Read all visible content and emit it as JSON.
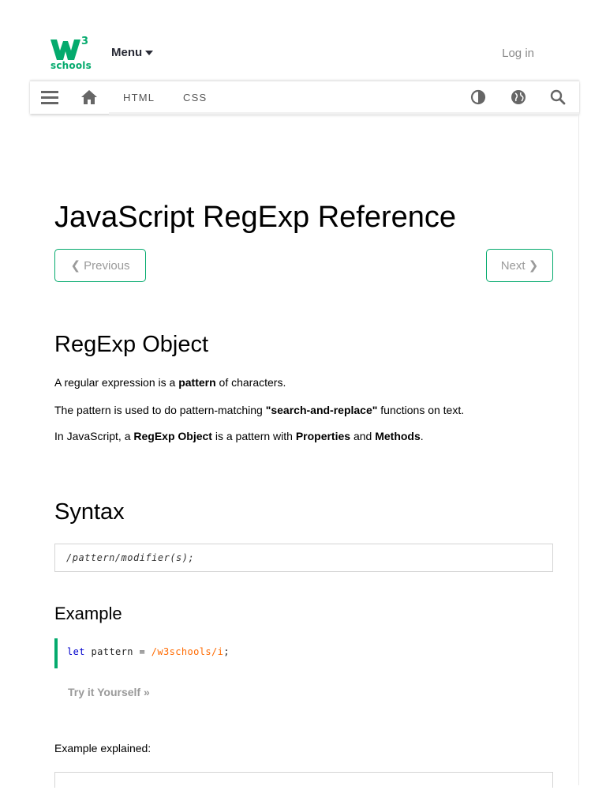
{
  "header": {
    "logo_text": "schools",
    "logo_superscript": "3",
    "menu_label": "Menu",
    "login_label": "Log in"
  },
  "navbar": {
    "links": [
      "HTML",
      "CSS"
    ],
    "icons": [
      "hamburger-menu-icon",
      "home-icon",
      "contrast-icon",
      "globe-icon",
      "search-icon"
    ]
  },
  "page": {
    "title": "JavaScript RegExp Reference",
    "previous_label": "❮ Previous",
    "next_label": "Next ❯"
  },
  "regexp_object": {
    "heading": "RegExp Object",
    "p1_pre": "A regular expression is a ",
    "p1_bold": "pattern",
    "p1_post": " of characters.",
    "p2_pre": "The pattern is used to do pattern-matching ",
    "p2_bold": "\"search-and-replace\"",
    "p2_post": " functions on text.",
    "p3_pre": "In JavaScript, a ",
    "p3_bold1": "RegExp Object",
    "p3_mid": " is a pattern with ",
    "p3_bold2": "Properties",
    "p3_and": " and ",
    "p3_bold3": "Methods",
    "p3_post": "."
  },
  "syntax": {
    "heading": "Syntax",
    "code": "/pattern/modifier(s);"
  },
  "example": {
    "heading": "Example",
    "code_keyword": "let",
    "code_ident": " pattern = ",
    "code_regex": "/w3schools/i",
    "code_end": ";",
    "tryit_label": "Try it Yourself »",
    "explained_label": "Example explained:"
  },
  "colors": {
    "brand_green": "#04AA6D",
    "muted_text": "#9a9a9a"
  }
}
